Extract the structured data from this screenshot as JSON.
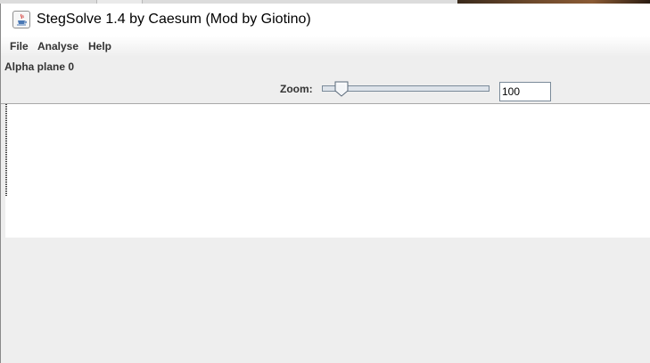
{
  "window": {
    "title": "StegSolve 1.4 by Caesum (Mod by Giotino)",
    "icon": "java-cup-icon"
  },
  "menu": {
    "items": [
      "File",
      "Analyse",
      "Help"
    ]
  },
  "view": {
    "plane_label": "Alpha plane 0",
    "zoom_label": "Zoom:",
    "zoom_value": "100",
    "zoom_slider_fraction": 0.08
  },
  "colors": {
    "window_bg": "#eeeeee",
    "canvas_bg": "#ffffff",
    "title_bg": "#ffffff"
  }
}
